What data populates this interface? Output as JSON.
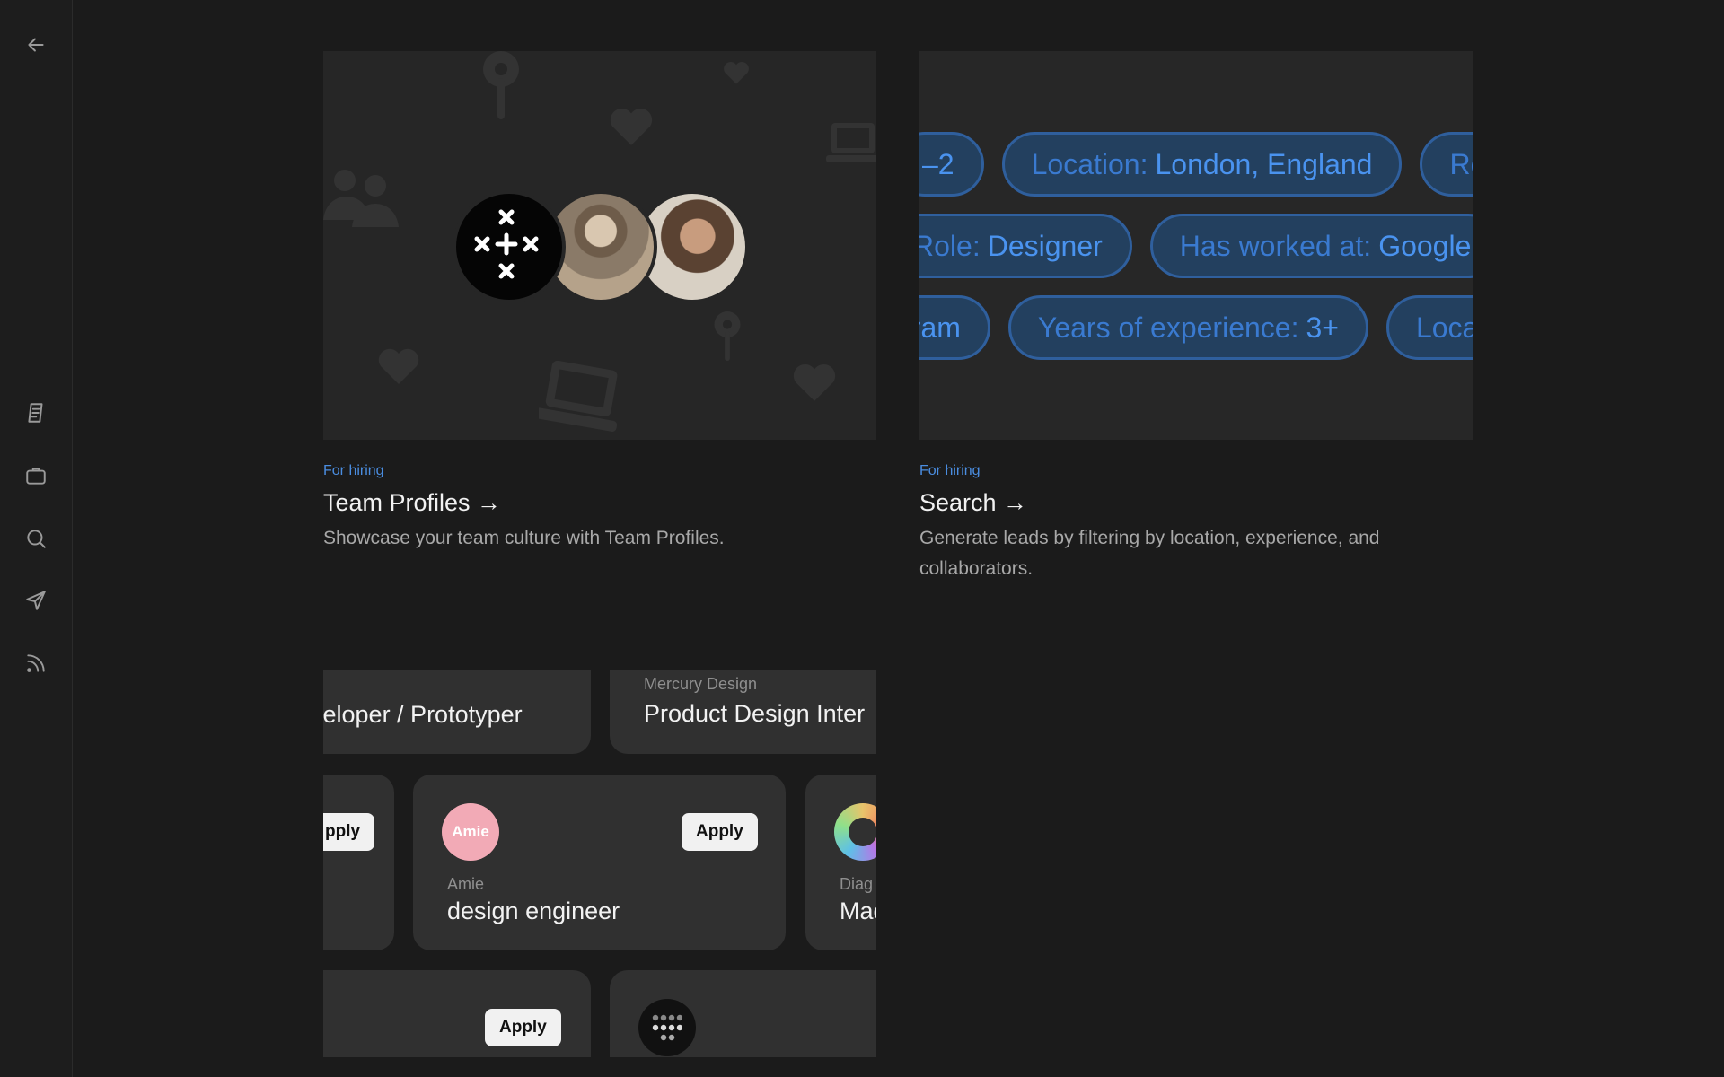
{
  "sidebar": {
    "items": [
      {
        "icon": "back-arrow-icon"
      },
      {
        "icon": "document-icon"
      },
      {
        "icon": "briefcase-icon"
      },
      {
        "icon": "search-icon"
      },
      {
        "icon": "send-icon"
      },
      {
        "icon": "feed-icon"
      }
    ]
  },
  "cards": {
    "team_profiles": {
      "eyebrow": "For hiring",
      "title": "Team Profiles →",
      "description": "Showcase your team culture with Team Profiles."
    },
    "search": {
      "eyebrow": "For hiring",
      "title": "Search →",
      "description_line1": "Generate leads by filtering by location, experience, and",
      "description_line2": "collaborators.",
      "pills_row1": [
        {
          "key": "",
          "value": "–2"
        },
        {
          "key": "Location:",
          "value": "London, England"
        },
        {
          "key": "Ro",
          "value": ""
        }
      ],
      "pills_row2": [
        {
          "key": "Role:",
          "value": "Designer"
        },
        {
          "key": "Has worked at:",
          "value": "Google"
        }
      ],
      "pills_row3": [
        {
          "key": "",
          "value": "gram"
        },
        {
          "key": "Years of experience:",
          "value": "3+"
        },
        {
          "key": "Loca",
          "value": ""
        }
      ]
    }
  },
  "jobs": {
    "top_left_role": "veloper / Prototyper",
    "top_right_company": "Mercury Design",
    "top_right_role": "Product Design Inter",
    "mid_left_apply": "pply",
    "amie_avatar_label": "Amie",
    "amie_apply": "Apply",
    "amie_company": "Amie",
    "amie_role": "design engineer",
    "mid_right_company": "Diag",
    "mid_right_role": "Mac",
    "bottom_left_apply": "Apply"
  },
  "colors": {
    "accent": "#4a8de0",
    "background": "#1b1b1b",
    "pill_fill": "#23405f",
    "amie_avatar": "#f2aab6"
  }
}
